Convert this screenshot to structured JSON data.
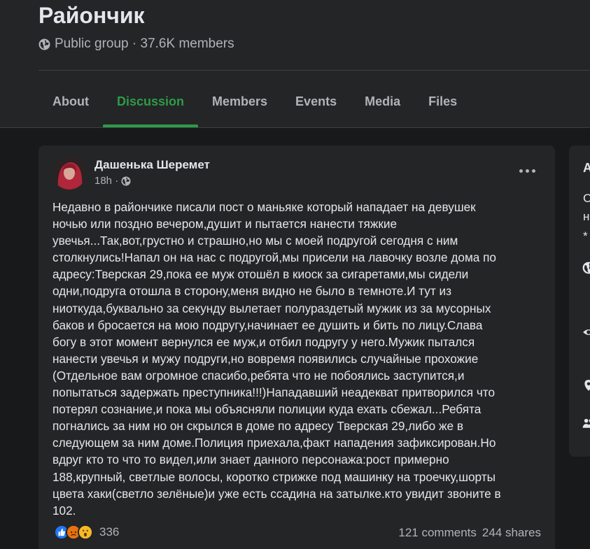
{
  "group": {
    "title": "Райончик",
    "meta": "Public group · 37.6K members"
  },
  "tabs": [
    {
      "label": "About",
      "active": false
    },
    {
      "label": "Discussion",
      "active": true
    },
    {
      "label": "Members",
      "active": false
    },
    {
      "label": "Events",
      "active": false
    },
    {
      "label": "Media",
      "active": false
    },
    {
      "label": "Files",
      "active": false
    }
  ],
  "post": {
    "author": "Дашенька Шеремет",
    "time": "18h ·",
    "lines": [
      "Недавно в райончике писали пост о маньяке который нападает на девушек",
      "ночью или поздно вечером,душит и пытается нанести тяжкие",
      "увечья...Так,вот,грустно и страшно,но мы с моей подругой сегодня с ним",
      "столкнулись!Напал он на нас с подругой,мы присели на лавочку возле дома по",
      "адресу:Тверская 29,пока ее муж отошёл в киоск за сигаретами,мы сидели",
      "одни,подруга отошла в сторону,меня видно не было в темноте.И тут из",
      "ниоткуда,буквально за секунду вылетает полураздетый  мужик из за мусорных",
      "баков и бросается на мою подругу,начинает ее душить и бить по лицу.Слава",
      "богу в этот момент вернулся ее муж,и отбил подругу у него.Мужик пытался",
      "нанести увечья и мужу подруги,но вовремя появились случайные прохожие",
      "(Отдельное вам огромное спасибо,ребята что не побоялись заступится,и",
      "попытаться задержать преступника!!!)Нападавший неадекват притворился что",
      "потерял сознание,и пока мы объясняли полиции куда ехать сбежал...Ребята",
      "погнались за ним но он скрылся в доме по адресу Тверская 29,либо же в",
      "следующем за ним доме.Полиция приехала,факт нападения зафиксирован.Но",
      "вдруг кто то что то видел,или знает данного персонажа:рост примерно",
      "188,крупный, светлые волосы, коротко стрижке под машинку на троечку,шорты",
      "цвета хаки(светло зелёные)и уже есть ссадина на затылке.кто увидит звоните в",
      "102."
    ],
    "reaction_count": "336",
    "comments": "121 comments",
    "shares": "244 shares"
  },
  "side": {
    "letters": [
      "A",
      "C",
      "н",
      "*"
    ]
  },
  "colors": {
    "accent": "#2d9b48",
    "background": "#18191a",
    "card": "#242526",
    "text_primary": "#e4e6eb",
    "text_secondary": "#b0b3b8",
    "like": "#2078f4"
  },
  "icons": [
    "globe-icon",
    "more-icon",
    "like-icon",
    "angry-icon",
    "wow-icon",
    "eye-icon",
    "pin-icon",
    "people-icon"
  ]
}
